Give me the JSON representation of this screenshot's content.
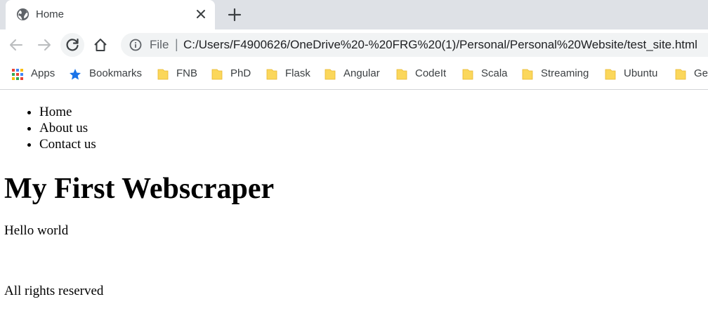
{
  "browser": {
    "tab": {
      "title": "Home",
      "favicon": "globe-icon"
    },
    "toolbar": {
      "back": "back-arrow-icon",
      "forward": "forward-arrow-icon",
      "reload": "reload-icon",
      "home": "home-icon",
      "omnibox": {
        "scheme_label": "File",
        "separator": "|",
        "url": "C:/Users/F4900626/OneDrive%20-%20FRG%20(1)/Personal/Personal%20Website/test_site.html"
      }
    },
    "bookmarks": [
      {
        "label": "Apps",
        "icon": "apps-grid-icon"
      },
      {
        "label": "Bookmarks",
        "icon": "star-icon"
      },
      {
        "label": "FNB",
        "icon": "folder-icon"
      },
      {
        "label": "PhD",
        "icon": "folder-icon"
      },
      {
        "label": "Flask",
        "icon": "folder-icon"
      },
      {
        "label": "Angular",
        "icon": "folder-icon"
      },
      {
        "label": "CodeIt",
        "icon": "folder-icon"
      },
      {
        "label": "Scala",
        "icon": "folder-icon"
      },
      {
        "label": "Streaming",
        "icon": "folder-icon"
      },
      {
        "label": "Ubuntu",
        "icon": "folder-icon"
      },
      {
        "label": "Ge",
        "icon": "folder-icon"
      }
    ]
  },
  "page": {
    "nav": [
      "Home",
      "About us",
      "Contact us"
    ],
    "heading": "My First Webscraper",
    "paragraph": "Hello world",
    "footer": "All rights reserved"
  },
  "colors": {
    "tabstrip": "#dee1e6",
    "omnibox": "#f1f3f4",
    "folder": "#fbd75b",
    "star": "#1a73e8"
  }
}
